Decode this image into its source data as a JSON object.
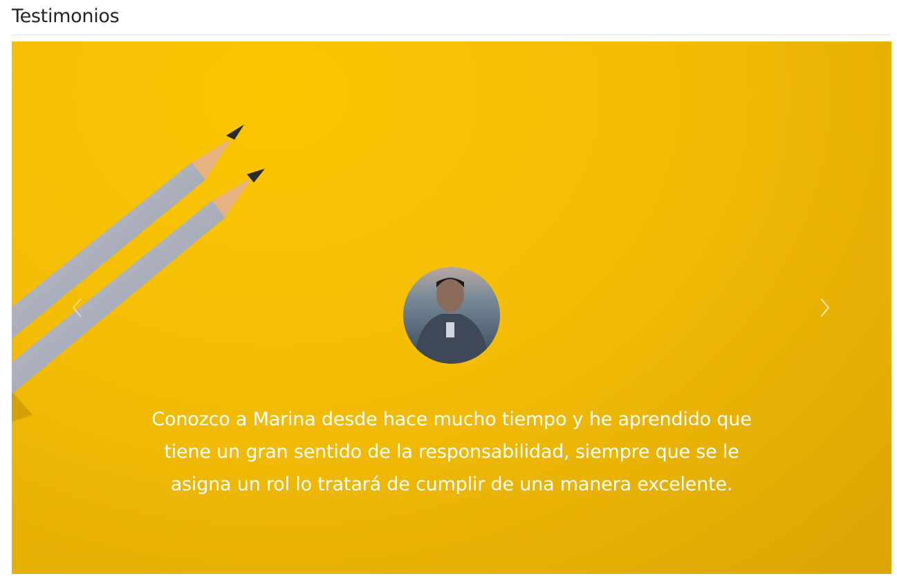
{
  "section": {
    "title": "Testimonios"
  },
  "carousel": {
    "colors": {
      "background": "#f3bd05",
      "text": "#ffffff"
    },
    "prev_icon": "chevron-left-icon",
    "next_icon": "chevron-right-icon",
    "active_slide": {
      "quote": "Conozco a Marina desde hace mucho tiempo y he aprendido que tiene un gran sentido de la responsabilidad, siempre que se le asigna un rol lo tratará de cumplir de una manera excelente."
    }
  }
}
